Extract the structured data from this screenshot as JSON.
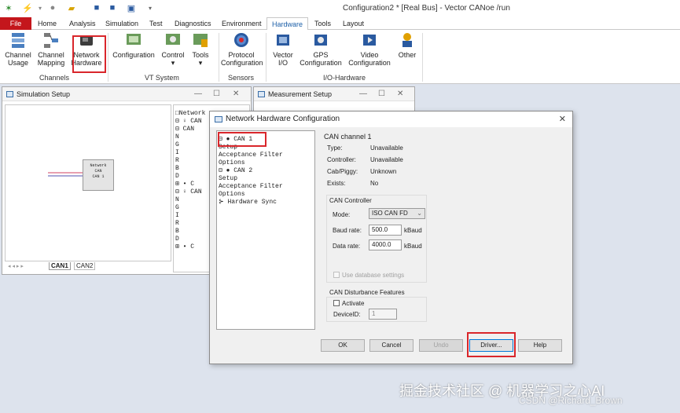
{
  "app": {
    "title": "Configuration2 * [Real Bus] - Vector CANoe /run"
  },
  "menu": {
    "file": "File",
    "items": [
      "Home",
      "Analysis",
      "Simulation",
      "Test",
      "Diagnostics",
      "Environment",
      "Hardware",
      "Tools",
      "Layout"
    ]
  },
  "ribbon": {
    "buttons": [
      {
        "label1": "Channel",
        "label2": "Usage"
      },
      {
        "label1": "Channel",
        "label2": "Mapping"
      },
      {
        "label1": "Network",
        "label2": "Hardware"
      },
      {
        "label1": "Configuration",
        "label2": ""
      },
      {
        "label1": "Control",
        "label2": "▾"
      },
      {
        "label1": "Tools",
        "label2": "▾"
      },
      {
        "label1": "Protocol",
        "label2": "Configuration"
      },
      {
        "label1": "Vector",
        "label2": "I/O"
      },
      {
        "label1": "GPS",
        "label2": "Configuration"
      },
      {
        "label1": "Video",
        "label2": "Configuration"
      },
      {
        "label1": "Other",
        "label2": ""
      }
    ],
    "groups": [
      "Channels",
      "VT System",
      "Sensors",
      "I/O-Hardware"
    ]
  },
  "sim": {
    "title": "Simulation Setup",
    "node1": "Network",
    "node2": "CAN",
    "node3": "CAN 1",
    "tabs": [
      "CAN1",
      "CAN2"
    ],
    "tree": [
      "□Network",
      "⊟ ♀ CAN",
      "  ⊟ CAN",
      "    N",
      "    G",
      "    I",
      "    R",
      "    B",
      "    D",
      "  ⊞ • C",
      "⊟ ♀ CAN",
      "    N",
      "    G",
      "    I",
      "    R",
      "    B",
      "    D",
      "  ⊞ • C"
    ]
  },
  "meas": {
    "title": "Measurement Setup"
  },
  "dialog": {
    "title": "Network Hardware Configuration",
    "tree": [
      "⊟ ● CAN 1",
      "    Setup",
      "    Acceptance Filter",
      "    Options",
      "⊟ ● CAN 2",
      "    Setup",
      "    Acceptance Filter",
      "    Options",
      "  ⊱ Hardware Sync"
    ],
    "channel_title": "CAN channel 1",
    "info": [
      {
        "k": "Type:",
        "v": "Unavailable"
      },
      {
        "k": "Controller:",
        "v": "Unavailable"
      },
      {
        "k": "Cab/Piggy:",
        "v": "Unknown"
      },
      {
        "k": "Exists:",
        "v": "No"
      }
    ],
    "controller_title": "CAN Controller",
    "mode_label": "Mode:",
    "mode_value": "ISO CAN FD",
    "baud_label": "Baud rate:",
    "baud_value": "500.0",
    "baud_unit": "kBaud",
    "data_label": "Data rate:",
    "data_value": "4000.0",
    "data_unit": "kBaud",
    "use_db": "Use database settings",
    "disturb_title": "CAN Disturbance Features",
    "activate": "Activate",
    "device_label": "DeviceID:",
    "device_value": "1",
    "buttons": {
      "ok": "OK",
      "cancel": "Cancel",
      "undo": "Undo",
      "driver": "Driver...",
      "help": "Help"
    }
  },
  "watermark": "掘金技术社区 @ 机器学习之心AI",
  "watermark2": "CSDN @Richard_Brown",
  "colors": {
    "accent": "#1c5fa8",
    "file": "#c4161c",
    "highlight": "#d9262b"
  }
}
